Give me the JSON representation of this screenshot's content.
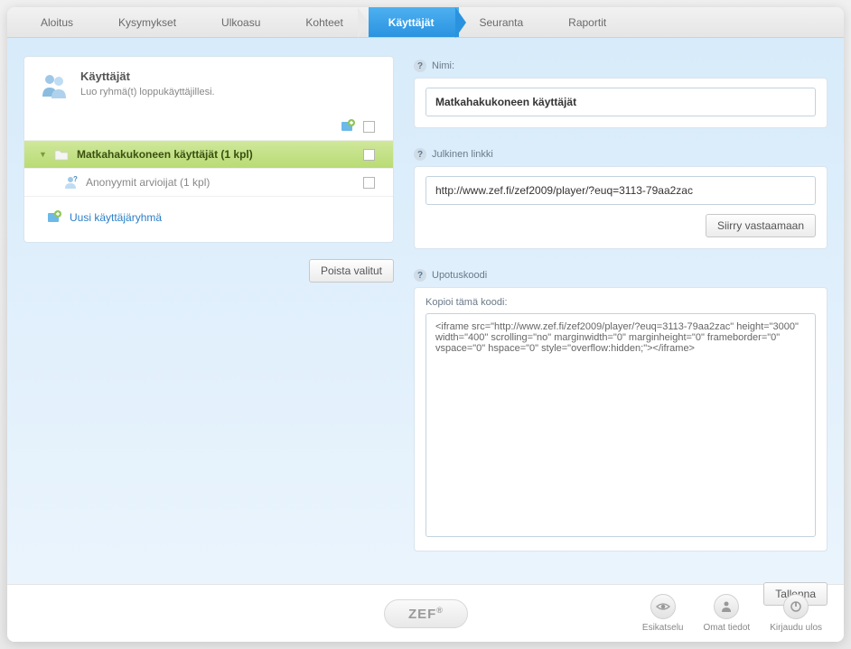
{
  "nav": {
    "tabs": [
      {
        "label": "Aloitus"
      },
      {
        "label": "Kysymykset"
      },
      {
        "label": "Ulkoasu"
      },
      {
        "label": "Kohteet"
      },
      {
        "label": "Käyttäjät",
        "active": true
      },
      {
        "label": "Seuranta"
      },
      {
        "label": "Raportit"
      }
    ]
  },
  "panel": {
    "title": "Käyttäjät",
    "subtitle": "Luo ryhmä(t) loppukäyttäjillesi."
  },
  "groups": {
    "selected": {
      "label": "Matkahakukoneen käyttäjät (1 kpl)"
    },
    "sub": {
      "label": "Anonyymit arvioijat (1 kpl)"
    },
    "new_link": "Uusi käyttäjäryhmä"
  },
  "left_actions": {
    "remove": "Poista valitut"
  },
  "right": {
    "name_label": "Nimi:",
    "name_value": "Matkahakukoneen käyttäjät",
    "link_label": "Julkinen linkki",
    "link_value": "http://www.zef.fi/zef2009/player/?euq=3113-79aa2zac",
    "goto_btn": "Siirry vastaamaan",
    "embed_section": "Upotuskoodi",
    "embed_label": "Kopioi tämä koodi:",
    "embed_value": "<iframe src=\"http://www.zef.fi/zef2009/player/?euq=3113-79aa2zac\" height=\"3000\" width=\"400\" scrolling=\"no\" marginwidth=\"0\" marginheight=\"0\" frameborder=\"0\" vspace=\"0\" hspace=\"0\" style=\"overflow:hidden;\"></iframe>",
    "save_btn": "Tallenna"
  },
  "footer": {
    "logo": "ZEF",
    "preview": "Esikatselu",
    "account": "Omat tiedot",
    "logout": "Kirjaudu ulos"
  }
}
